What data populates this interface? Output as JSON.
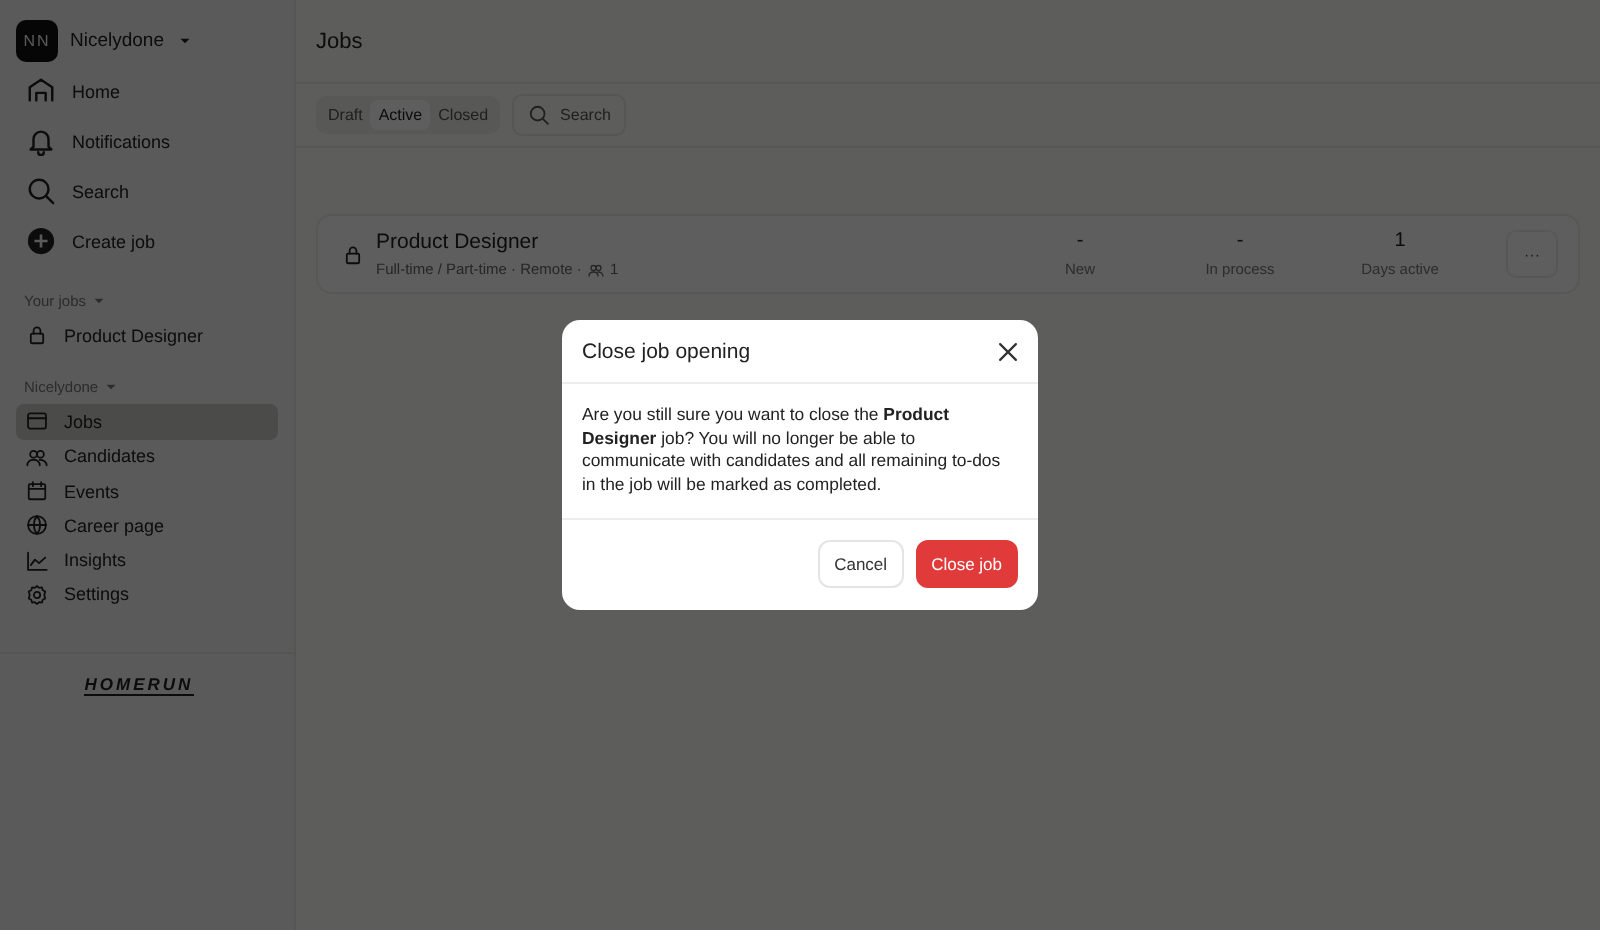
{
  "workspace": {
    "initials": "NN",
    "name": "Nicelydone"
  },
  "nav": [
    {
      "label": "Home",
      "kind": "home"
    },
    {
      "label": "Notifications",
      "kind": "bell"
    },
    {
      "label": "Search",
      "kind": "search"
    },
    {
      "label": "Create job",
      "kind": "plus"
    }
  ],
  "your_jobs": {
    "heading": "Your jobs",
    "items": [
      {
        "label": "Product Designer",
        "kind": "lock"
      }
    ]
  },
  "workspace_menu": {
    "heading": "Nicelydone",
    "items": [
      {
        "label": "Jobs",
        "kind": "jobs",
        "selected": true
      },
      {
        "label": "Candidates",
        "kind": "people",
        "selected": false
      },
      {
        "label": "Events",
        "kind": "calendar",
        "selected": false
      },
      {
        "label": "Career page",
        "kind": "globe",
        "selected": false
      },
      {
        "label": "Insights",
        "kind": "chart",
        "selected": false
      },
      {
        "label": "Settings",
        "kind": "gear",
        "selected": false
      }
    ]
  },
  "logo": "HOMERUN",
  "page": {
    "title": "Jobs",
    "filters": [
      {
        "label": "Draft",
        "selected": false
      },
      {
        "label": "Active",
        "selected": true
      },
      {
        "label": "Closed",
        "selected": false
      }
    ],
    "search": {
      "placeholder": "Search"
    }
  },
  "jobs": [
    {
      "title": "Product Designer",
      "meta": "Full-time / Part-time · Remote ·",
      "candidates": "1",
      "stats": [
        {
          "value": "-",
          "label": "New"
        },
        {
          "value": "-",
          "label": "In process"
        },
        {
          "value": "1",
          "label": "Days active"
        }
      ],
      "menu": "···"
    }
  ],
  "dialog": {
    "title": "Close job opening",
    "body": "Are you still sure you want to close the **Product Designer** job? You will no longer be able to communicate with candidates and all remaining to-dos in the job will be marked as completed.",
    "buttons": [
      {
        "label": "Cancel",
        "kind": "secondary"
      },
      {
        "label": "Close job",
        "kind": "danger"
      }
    ]
  }
}
